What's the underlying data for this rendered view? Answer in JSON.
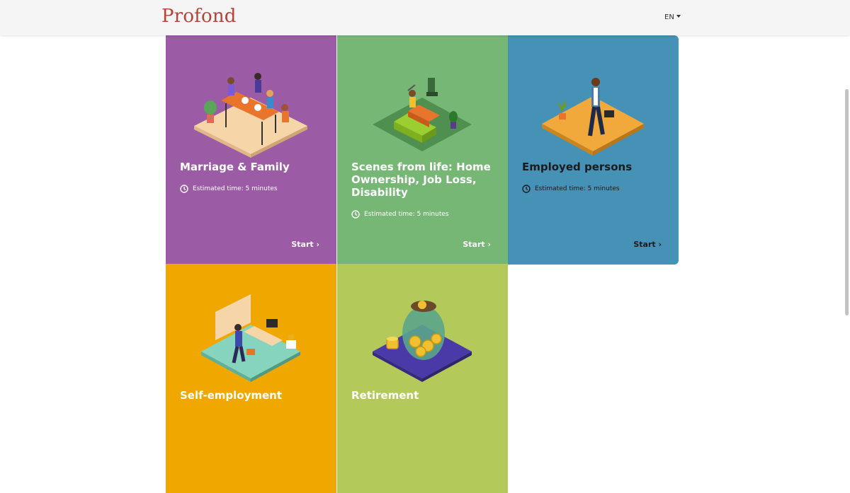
{
  "header": {
    "logo": "Profond",
    "language": "EN"
  },
  "cards": [
    {
      "title": "Marriage & Family",
      "time": "Estimated time: 5 minutes",
      "start": "Start ›",
      "color": "#9b5ca5",
      "icon": "marriage-family-illustration"
    },
    {
      "title": "Scenes from life: Home Ownership, Job Loss, Disability",
      "time": "Estimated time: 5 minutes",
      "start": "Start ›",
      "color": "#76b776",
      "icon": "home-ownership-illustration"
    },
    {
      "title": "Employed persons",
      "time": "Estimated time: 5 minutes",
      "start": "Start ›",
      "color": "#4691b6",
      "icon": "employed-person-illustration"
    },
    {
      "title": "Self-employment",
      "color": "#f0a800",
      "icon": "self-employment-illustration"
    },
    {
      "title": "Retirement",
      "color": "#b3c95a",
      "icon": "retirement-illustration"
    }
  ]
}
